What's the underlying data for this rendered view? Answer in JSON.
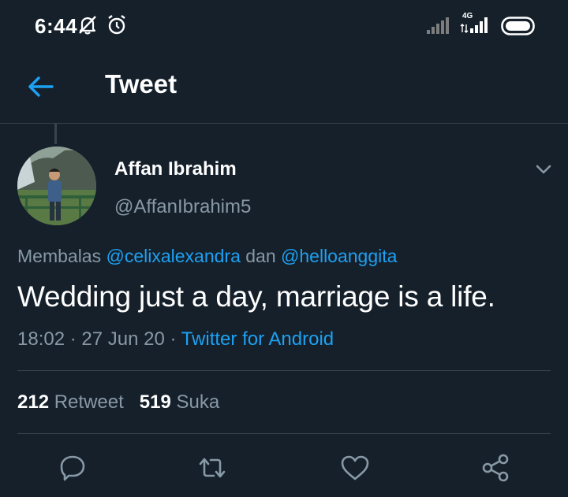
{
  "theme": {
    "background": "#15202b",
    "accent": "#1da1f2",
    "muted": "#8899a6",
    "divider": "#38444d"
  },
  "status_bar": {
    "time": "6:44",
    "network_label": "4G",
    "icons": [
      "bell-off-icon",
      "alarm-icon",
      "signal-icon",
      "signal-4g-icon",
      "battery-icon"
    ]
  },
  "header": {
    "title": "Tweet",
    "back_icon": "arrow-left-icon"
  },
  "tweet": {
    "author_name": "Affan Ibrahim",
    "author_handle": "@AffanIbrahim5",
    "replying_prefix": "Membalas ",
    "mention_1": "@celixalexandra",
    "replying_conj": " dan ",
    "mention_2": "@helloanggita",
    "text": "Wedding just a day, marriage is a life.",
    "time": "18:02",
    "sep_1": " · ",
    "date": "27 Jun 20",
    "sep_2": " · ",
    "source": "Twitter for Android"
  },
  "stats": {
    "retweets_count": "212",
    "retweets_label": "Retweet",
    "likes_count": "519",
    "likes_label": "Suka"
  },
  "actions": [
    "reply-icon",
    "retweet-icon",
    "like-icon",
    "share-icon"
  ]
}
